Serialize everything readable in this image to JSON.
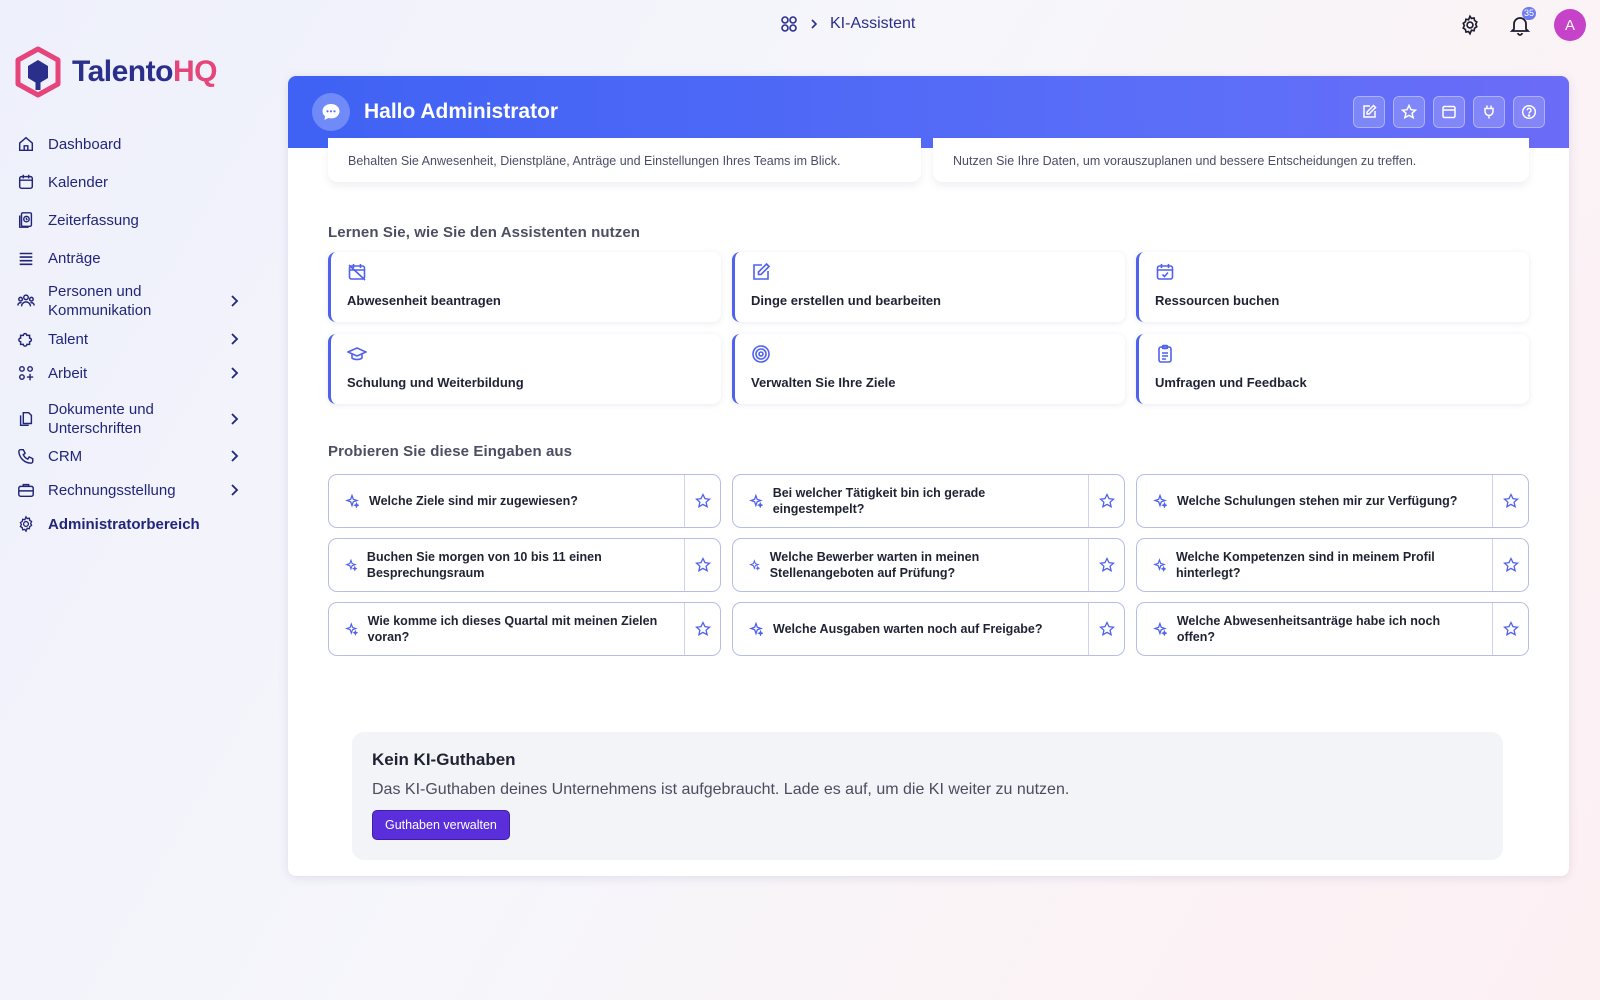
{
  "breadcrumb": {
    "page": "KI-Assistent",
    "home_icon": "apps-grid-icon",
    "separator_icon": "chevron-right-icon"
  },
  "topbar": {
    "settings_icon": "gear-icon",
    "bell_icon": "bell-icon",
    "notification_count": "35",
    "avatar_initial": "A",
    "avatar_color": "#c643c9"
  },
  "logo": {
    "part1": "Talento",
    "part2": "HQ",
    "colors": {
      "primary": "#2b2f8c",
      "accent": "#e5457a"
    }
  },
  "sidebar": {
    "items": [
      {
        "label": "Dashboard",
        "icon": "home-icon",
        "expandable": false
      },
      {
        "label": "Kalender",
        "icon": "calendar-icon",
        "expandable": false
      },
      {
        "label": "Zeiterfassung",
        "icon": "clock-file-icon",
        "expandable": false
      },
      {
        "label": "Anträge",
        "icon": "list-icon",
        "expandable": false
      },
      {
        "label": "Personen und Kommunikation",
        "icon": "people-icon",
        "expandable": true
      },
      {
        "label": "Talent",
        "icon": "puzzle-icon",
        "expandable": true
      },
      {
        "label": "Arbeit",
        "icon": "apps-plus-icon",
        "expandable": true
      },
      {
        "label": "Dokumente und Unterschriften",
        "icon": "documents-icon",
        "expandable": true
      },
      {
        "label": "CRM",
        "icon": "phone-icon",
        "expandable": true
      },
      {
        "label": "Rechnungsstellung",
        "icon": "briefcase-icon",
        "expandable": true
      },
      {
        "label": "Administratorbereich",
        "icon": "gear-icon",
        "expandable": false
      }
    ]
  },
  "main": {
    "title": "Hallo Administrator",
    "header_actions": [
      "edit-icon",
      "star-icon",
      "window-icon",
      "plug-icon",
      "help-icon"
    ],
    "top_cards": [
      "Behalten Sie Anwesenheit, Dienstpläne, Anträge und Einstellungen Ihres Teams im Blick.",
      "Nutzen Sie Ihre Daten, um vorauszuplanen und bessere Entscheidungen zu treffen."
    ],
    "learn_title": "Lernen Sie, wie Sie den Assistenten nutzen",
    "learn_cards": [
      {
        "label": "Abwesenheit beantragen",
        "icon": "calendar-off-icon"
      },
      {
        "label": "Dinge erstellen und bearbeiten",
        "icon": "edit-icon"
      },
      {
        "label": "Ressourcen buchen",
        "icon": "calendar-check-icon"
      },
      {
        "label": "Schulung und Weiterbildung",
        "icon": "graduation-cap-icon"
      },
      {
        "label": "Verwalten Sie Ihre Ziele",
        "icon": "target-icon"
      },
      {
        "label": "Umfragen und Feedback",
        "icon": "clipboard-list-icon"
      }
    ],
    "try_title": "Probieren Sie diese Eingaben aus",
    "prompts": [
      "Welche Ziele sind mir zugewiesen?",
      "Bei welcher Tätigkeit bin ich gerade eingestempelt?",
      "Welche Schulungen stehen mir zur Verfügung?",
      "Buchen Sie morgen von 10 bis 11 einen Besprechungsraum",
      "Welche Bewerber warten in meinen Stellenangeboten auf Prüfung?",
      "Welche Kompetenzen sind in meinem Profil hinterlegt?",
      "Wie komme ich dieses Quartal mit meinen Zielen voran?",
      "Welche Ausgaben warten noch auf Freigabe?",
      "Welche Abwesenheitsanträge habe ich noch offen?"
    ],
    "credit": {
      "title": "Kein KI-Guthaben",
      "text": "Das KI-Guthaben deines Unternehmens ist aufgebraucht. Lade es auf, um die KI weiter zu nutzen.",
      "button": "Guthaben verwalten"
    }
  },
  "colors": {
    "accent": "#4f62ee",
    "header_start": "#3f62f4",
    "button": "#5a2fdb"
  }
}
